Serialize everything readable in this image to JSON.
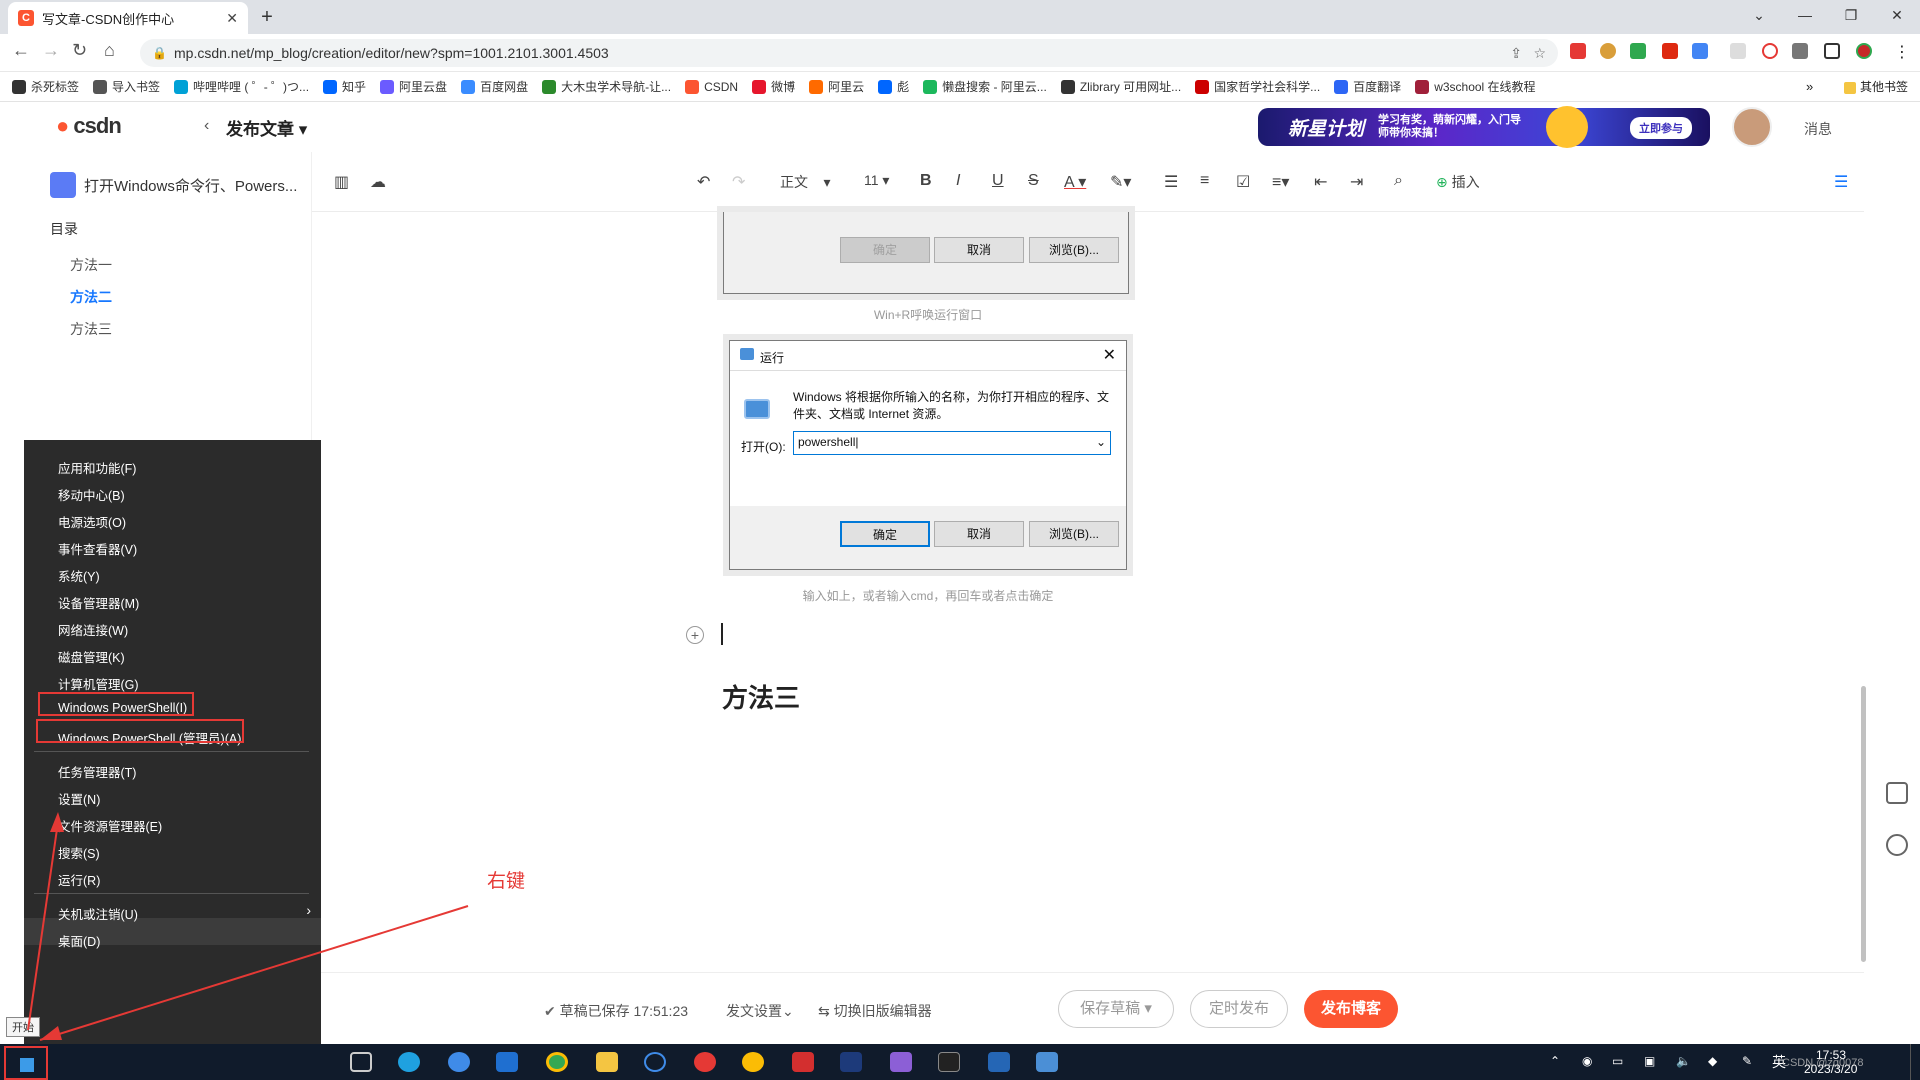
{
  "browser": {
    "tab_title": "写文章-CSDN创作中心",
    "tab_icon": "C",
    "url": "mp.csdn.net/mp_blog/creation/editor/new?spm=1001.2101.3001.4503"
  },
  "bookmarks": [
    {
      "label": "杀死标签",
      "color": "#333"
    },
    {
      "label": "导入书签",
      "color": "#555"
    },
    {
      "label": "哔哩哔哩 ( ゜- ゜)つ...",
      "color": "#00a1d6"
    },
    {
      "label": "知乎",
      "color": "#0066ff"
    },
    {
      "label": "阿里云盘",
      "color": "#6b5bff"
    },
    {
      "label": "百度网盘",
      "color": "#3a8cff"
    },
    {
      "label": "大木虫学术导航-让...",
      "color": "#2c8a2c"
    },
    {
      "label": "CSDN",
      "color": "#fc5531"
    },
    {
      "label": "微博",
      "color": "#e6162d"
    },
    {
      "label": "阿里云",
      "color": "#ff6a00"
    },
    {
      "label": "彪",
      "color": "#0066ff"
    },
    {
      "label": "懒盘搜索 - 阿里云...",
      "color": "#1cb85c"
    },
    {
      "label": "Zlibrary 可用网址...",
      "color": "#333"
    },
    {
      "label": "国家哲学社会科学...",
      "color": "#c00"
    },
    {
      "label": "百度翻译",
      "color": "#2d66f5"
    },
    {
      "label": "w3school 在线教程",
      "color": "#a0203a"
    }
  ],
  "bookmarks_other": "其他书签",
  "csdn": {
    "logo": "csdn",
    "back_label": "发布文章",
    "banner_text": "新星计划",
    "banner_sub": "学习有奖，萌新闪耀，入门导师带你来搞！",
    "banner_cta": "立即参与",
    "message_label": "消息"
  },
  "sidebar": {
    "doc_title": "打开Windows命令行、Powers...",
    "toc_heading": "目录",
    "toc_items": [
      "方法一",
      "方法二",
      "方法三"
    ]
  },
  "editor_toolbar": {
    "style_select": "正文",
    "size_select": "11",
    "insert_label": "插入"
  },
  "content": {
    "dialog1": {
      "ok": "确定",
      "cancel": "取消",
      "browse": "浏览(B)..."
    },
    "caption1": "Win+R呼唤运行窗口",
    "dialog2": {
      "title": "运行",
      "desc": "Windows 将根据你所输入的名称，为你打开相应的程序、文件夹、文档或 Internet 资源。",
      "open_label": "打开(O):",
      "input_value": "powershell",
      "ok": "确定",
      "cancel": "取消",
      "browse": "浏览(B)..."
    },
    "caption2": "输入如上，或者输入cmd，再回车或者点击确定",
    "heading": "方法三"
  },
  "winx_menu": {
    "items": [
      "应用和功能(F)",
      "移动中心(B)",
      "电源选项(O)",
      "事件查看器(V)",
      "系统(Y)",
      "设备管理器(M)",
      "网络连接(W)",
      "磁盘管理(K)",
      "计算机管理(G)",
      "Windows PowerShell(I)",
      "Windows PowerShell (管理员)(A)",
      "任务管理器(T)",
      "设置(N)",
      "文件资源管理器(E)",
      "搜索(S)",
      "运行(R)",
      "关机或注销(U)",
      "桌面(D)"
    ],
    "start_tooltip": "开始"
  },
  "annotation": {
    "label": "右键",
    "color": "#e53935"
  },
  "bottom_bar": {
    "draft_status": "草稿已保存 17:51:23",
    "publish_settings": "发文设置",
    "switch_editor": "切换旧版编辑器",
    "save_draft": "保存草稿",
    "schedule": "定时发布",
    "publish": "发布博客"
  },
  "taskbar": {
    "time": "17:53",
    "date": "2023/3/20",
    "ime": "英",
    "watermark": "CSDN @zq0078"
  }
}
